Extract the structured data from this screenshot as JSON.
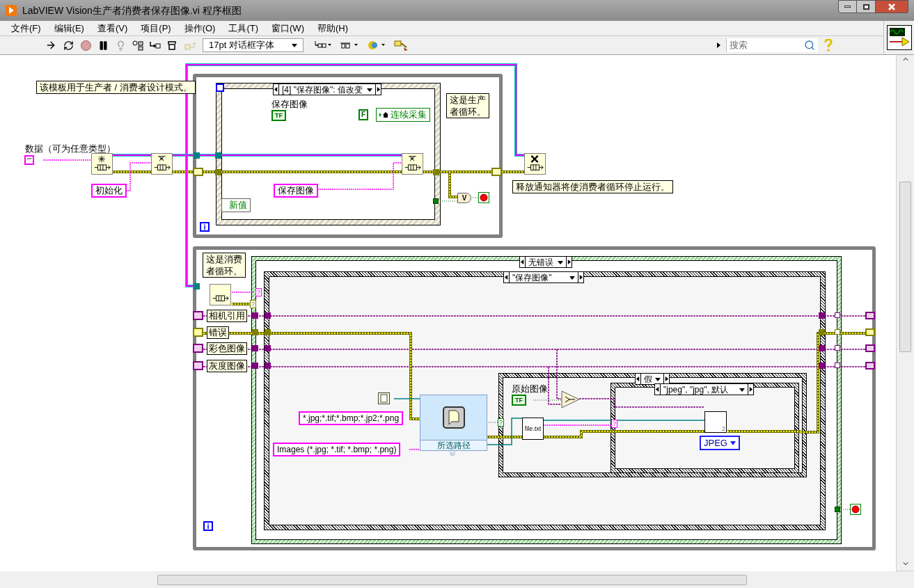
{
  "window": {
    "title": "LabVIEW Vision生产者消费者保存图像.vi 程序框图"
  },
  "menu": [
    "文件(F)",
    "编辑(E)",
    "查看(V)",
    "项目(P)",
    "操作(O)",
    "工具(T)",
    "窗口(W)",
    "帮助(H)"
  ],
  "toolbar": {
    "font": "17pt 对话框字体",
    "search": {
      "placeholder": "搜索"
    }
  },
  "diagram": {
    "template_note": "该模板用于生产者 / 消费者设计模式。",
    "data_label": "数据（可为任意类型）",
    "data_constant": "“”",
    "init_constant": "初始化",
    "producer_loop": {
      "event_case": "[4] \"保存图像\": 值改变",
      "button_label": "保存图像",
      "bool_terminal": "TF",
      "false_constant": "F",
      "local_variable": "连续采集",
      "event_data": "新值",
      "enqueue_constant": "保存图像",
      "note": "这是生产者循环。",
      "iteration": "i",
      "or_symbol": "V"
    },
    "release_note": "释放通知器将使消费者循环停止运行。",
    "consumer_loop": {
      "note": "这是消费者循环。",
      "iteration": "i",
      "shift_registers": [
        {
          "name": "相机引用",
          "kind": "ref"
        },
        {
          "name": "错误",
          "kind": "error"
        },
        {
          "name": "彩色图像",
          "kind": "ref"
        },
        {
          "name": "灰度图像",
          "kind": "ref"
        }
      ],
      "error_case": "无错误",
      "state_case": "\"保存图像\"",
      "file_filter": "*.jpg;*.tif;*.bmp;*.jp2;*.png",
      "file_type_label": "Images (*.jpg; *.tif; *.bmp; *.png)",
      "dialog_output": "所选路径",
      "bool_label": "原始图像",
      "bool_terminal": "TF",
      "bool_case": "假",
      "format_case": "\"jpeg\", \"jpg\", 默认",
      "default_file": "file.txt",
      "format_constant": "JPEG",
      "save_badge": "2",
      "unwired_marks": [
        {
          "text": "?",
          "color": "#ff00ff"
        },
        {
          "text": "?",
          "color": "#808000"
        },
        {
          "text": "?",
          "color": "#008000"
        },
        {
          "text": "?",
          "color": "#ff00ff"
        }
      ]
    }
  }
}
